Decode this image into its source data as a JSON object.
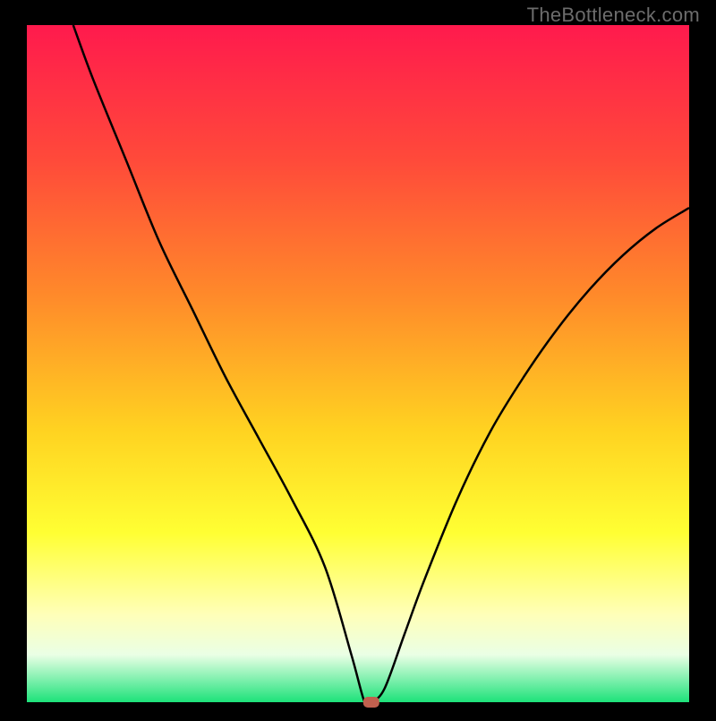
{
  "watermark": "TheBottleneck.com",
  "chart_data": {
    "type": "line",
    "title": "",
    "xlabel": "",
    "ylabel": "",
    "xlim": [
      0,
      100
    ],
    "ylim": [
      0,
      100
    ],
    "axes_shown": false,
    "grid": false,
    "background_gradient": {
      "direction": "vertical",
      "stops": [
        {
          "pos": 0.0,
          "color": "#ff1a4d"
        },
        {
          "pos": 0.2,
          "color": "#ff4a3a"
        },
        {
          "pos": 0.4,
          "color": "#ff8a2a"
        },
        {
          "pos": 0.6,
          "color": "#ffd321"
        },
        {
          "pos": 0.75,
          "color": "#ffff33"
        },
        {
          "pos": 0.87,
          "color": "#ffffb8"
        },
        {
          "pos": 0.93,
          "color": "#eaffe5"
        },
        {
          "pos": 1.0,
          "color": "#1de27a"
        }
      ]
    },
    "series": [
      {
        "name": "bottleneck-curve",
        "color": "#000000",
        "x": [
          7,
          10,
          15,
          20,
          25,
          30,
          35,
          40,
          45,
          49,
          51,
          52,
          54,
          57,
          60,
          65,
          70,
          75,
          80,
          85,
          90,
          95,
          100
        ],
        "y": [
          100,
          92,
          80,
          68,
          58,
          48,
          39,
          30,
          20,
          7,
          0,
          0,
          2,
          10,
          18,
          30,
          40,
          48,
          55,
          61,
          66,
          70,
          73
        ]
      }
    ],
    "marker": {
      "name": "optimal-point",
      "x": 52,
      "y": 0,
      "color": "#c0604e",
      "shape": "rounded-rect"
    }
  }
}
